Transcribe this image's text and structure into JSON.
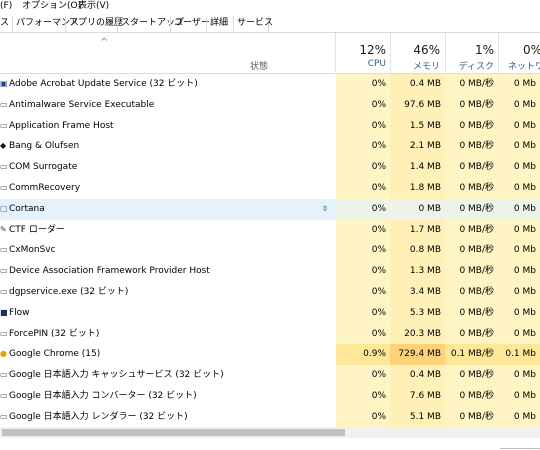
{
  "menu": [
    "(F)",
    "オプション(O)",
    "表示(V)"
  ],
  "tabs": [
    "ス",
    "パフォーマンス",
    "アプリの履歴",
    "スタートアップ",
    "ユーザー",
    "詳細",
    "サービス"
  ],
  "header": {
    "sort_arrow": "^",
    "status": "状態",
    "cpu_pct": "12%",
    "cpu_label": "CPU",
    "mem_pct": "46%",
    "mem_label": "メモリ",
    "disk_pct": "1%",
    "disk_label": "ディスク",
    "net_pct": "0%",
    "net_label": "ネットワー"
  },
  "rows": [
    {
      "name": "Adobe Acrobat Update Service (32 ビット)",
      "icon": "adobe-service-icon",
      "cpu": "0%",
      "mem": "0.4 MB",
      "disk": "0 MB/秒",
      "net": "0 Mb"
    },
    {
      "name": "Antimalware Service Executable",
      "icon": "service-icon",
      "cpu": "0%",
      "mem": "97.6 MB",
      "disk": "0 MB/秒",
      "net": "0 Mb"
    },
    {
      "name": "Application Frame Host",
      "icon": "window-icon",
      "cpu": "0%",
      "mem": "1.5 MB",
      "disk": "0 MB/秒",
      "net": "0 Mb"
    },
    {
      "name": "Bang & Olufsen",
      "icon": "bang-olufsen-icon",
      "cpu": "0%",
      "mem": "2.1 MB",
      "disk": "0 MB/秒",
      "net": "0 Mb"
    },
    {
      "name": "COM Surrogate",
      "icon": "window-icon",
      "cpu": "0%",
      "mem": "1.4 MB",
      "disk": "0 MB/秒",
      "net": "0 Mb"
    },
    {
      "name": "CommRecovery",
      "icon": "window-icon",
      "cpu": "0%",
      "mem": "1.8 MB",
      "disk": "0 MB/秒",
      "net": "0 Mb"
    },
    {
      "name": "Cortana",
      "icon": "cortana-icon",
      "cpu": "0%",
      "mem": "0 MB",
      "disk": "0 MB/秒",
      "net": "0 Mb",
      "selected": true,
      "suspended": true
    },
    {
      "name": "CTF ローダー",
      "icon": "ctf-icon",
      "cpu": "0%",
      "mem": "1.7 MB",
      "disk": "0 MB/秒",
      "net": "0 Mb"
    },
    {
      "name": "CxMonSvc",
      "icon": "window-icon",
      "cpu": "0%",
      "mem": "0.8 MB",
      "disk": "0 MB/秒",
      "net": "0 Mb"
    },
    {
      "name": "Device Association Framework Provider Host",
      "icon": "window-icon",
      "cpu": "0%",
      "mem": "1.3 MB",
      "disk": "0 MB/秒",
      "net": "0 Mb"
    },
    {
      "name": "dgpservice.exe (32 ビット)",
      "icon": "window-icon",
      "cpu": "0%",
      "mem": "3.4 MB",
      "disk": "0 MB/秒",
      "net": "0 Mb"
    },
    {
      "name": "Flow",
      "icon": "flow-icon",
      "cpu": "0%",
      "mem": "5.3 MB",
      "disk": "0 MB/秒",
      "net": "0 Mb"
    },
    {
      "name": "ForcePIN (32 ビット)",
      "icon": "window-icon",
      "cpu": "0%",
      "mem": "20.3 MB",
      "disk": "0 MB/秒",
      "net": "0 Mb"
    },
    {
      "name": "Google Chrome (15)",
      "icon": "chrome-icon",
      "cpu": "0.9%",
      "mem": "729.4 MB",
      "disk": "0.1 MB/秒",
      "net": "0.1 Mb",
      "hot": true
    },
    {
      "name": "Google 日本語入力 キャッシュサービス (32 ビット)",
      "icon": "window-icon",
      "cpu": "0%",
      "mem": "0.4 MB",
      "disk": "0 MB/秒",
      "net": "0 Mb"
    },
    {
      "name": "Google 日本語入力 コンバーター (32 ビット)",
      "icon": "window-icon",
      "cpu": "0%",
      "mem": "7.6 MB",
      "disk": "0 MB/秒",
      "net": "0 Mb"
    },
    {
      "name": "Google 日本語入力 レンダラー (32 ビット)",
      "icon": "window-icon",
      "cpu": "0%",
      "mem": "5.1 MB",
      "disk": "0 MB/秒",
      "net": "0 Mb"
    }
  ],
  "colors": {
    "heat_low": "#fff4c4",
    "heat_mid": "#ffe79a",
    "heat_high": "#ffd27a",
    "selected": "#e5f1fb"
  }
}
